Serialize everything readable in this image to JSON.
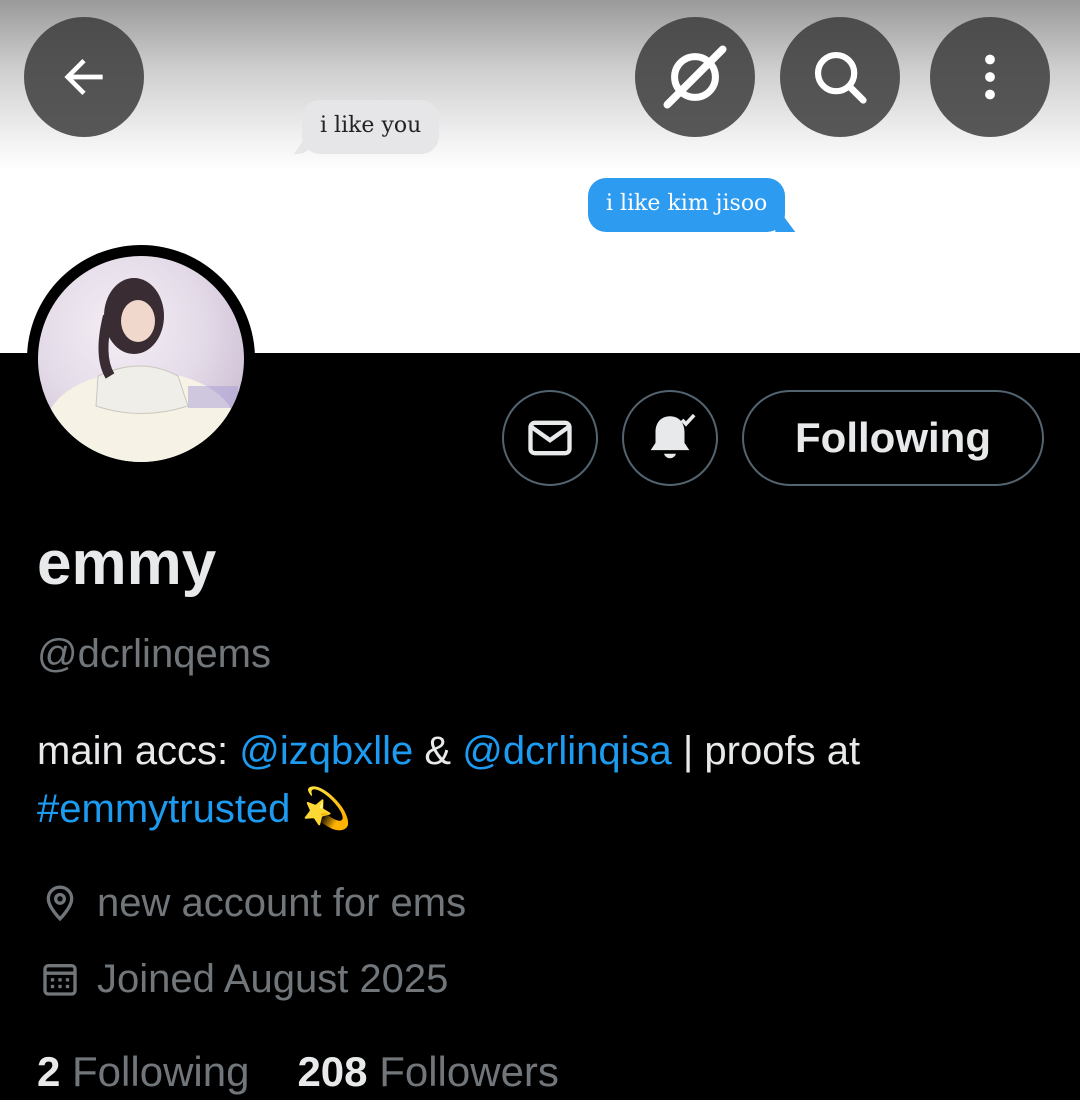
{
  "banner": {
    "message_received": "i like you",
    "message_sent": "i like kim jisoo"
  },
  "header": {
    "back_icon": "arrow-left-icon",
    "grok_icon": "grok-icon",
    "search_icon": "search-icon",
    "more_icon": "more-vertical-icon"
  },
  "actions": {
    "message_icon": "envelope-icon",
    "notify_icon": "bell-check-icon",
    "follow_label": "Following"
  },
  "profile": {
    "name": "emmy",
    "handle": "@dcrlinqems",
    "bio": {
      "prefix": "main accs: ",
      "mention1": "@izqbxlle",
      "amp": " & ",
      "mention2": "@dcrlinqisa",
      "mid": " | proofs at ",
      "hashtag": "#emmytrusted",
      "emoji": "💫"
    },
    "location": "new account for ems",
    "joined": "Joined August 2025",
    "following_count": "2",
    "following_label": "Following",
    "followers_count": "208",
    "followers_label": "Followers"
  },
  "colors": {
    "background": "#000000",
    "text": "#e7e9ea",
    "secondary": "#71767b",
    "accent": "#1d9bf0",
    "border": "#536471"
  }
}
